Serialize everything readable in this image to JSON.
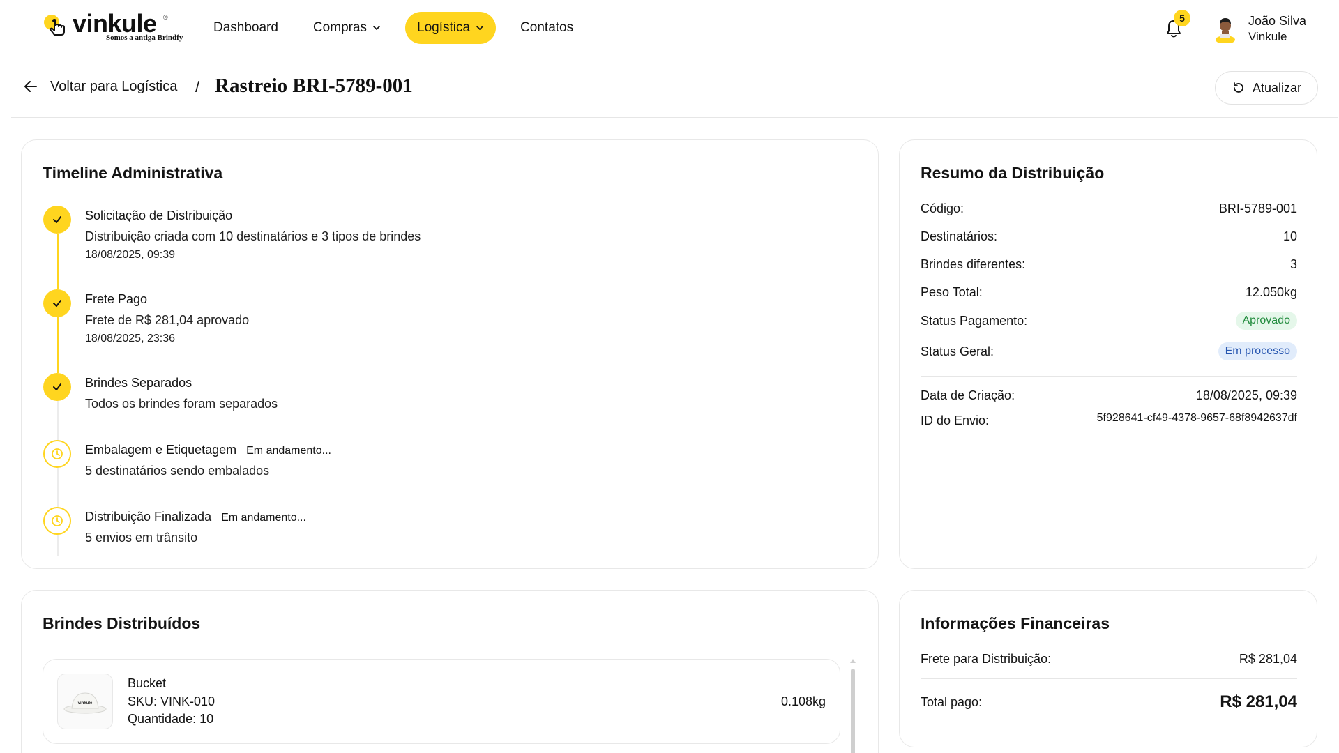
{
  "brand": {
    "name": "vinkule",
    "registered": "®",
    "tagline": "Somos a antiga Brindfy",
    "accent": "#ffd51f"
  },
  "nav": {
    "items": [
      {
        "label": "Dashboard",
        "has_dropdown": false,
        "active": false
      },
      {
        "label": "Compras",
        "has_dropdown": true,
        "active": false
      },
      {
        "label": "Logística",
        "has_dropdown": true,
        "active": true
      },
      {
        "label": "Contatos",
        "has_dropdown": false,
        "active": false
      }
    ]
  },
  "notifications": {
    "count": "5",
    "icon": "bell-icon"
  },
  "user": {
    "name": "João Silva",
    "org": "Vinkule"
  },
  "subheader": {
    "back_label": "Voltar para Logística",
    "separator": "/",
    "title": "Rastreio BRI-5789-001",
    "refresh_label": "Atualizar"
  },
  "timeline": {
    "title": "Timeline Administrativa",
    "steps": [
      {
        "title": "Solicitação de Distribuição",
        "status": "",
        "desc": "Distribuição criada com 10 destinatários e 3 tipos de brindes",
        "date": "18/08/2025, 09:39",
        "done": true
      },
      {
        "title": "Frete Pago",
        "status": "",
        "desc": "Frete de R$ 281,04 aprovado",
        "date": "18/08/2025, 23:36",
        "done": true
      },
      {
        "title": "Brindes Separados",
        "status": "",
        "desc": "Todos os brindes foram separados",
        "date": "",
        "done": true
      },
      {
        "title": "Embalagem e Etiquetagem",
        "status": "Em andamento...",
        "desc": "5 destinatários sendo embalados",
        "date": "",
        "done": false
      },
      {
        "title": "Distribuição Finalizada",
        "status": "Em andamento...",
        "desc": "5 envios em trânsito",
        "date": "",
        "done": false
      }
    ]
  },
  "summary": {
    "title": "Resumo da Distribuição",
    "rows": [
      {
        "label": "Código:",
        "value": "BRI-5789-001"
      },
      {
        "label": "Destinatários:",
        "value": "10"
      },
      {
        "label": "Brindes diferentes:",
        "value": "3"
      },
      {
        "label": "Peso Total:",
        "value": "12.050kg"
      }
    ],
    "payment_status": {
      "label": "Status Pagamento:",
      "value": "Aprovado",
      "color": "#1f8a3b"
    },
    "general_status": {
      "label": "Status Geral:",
      "value": "Em processo",
      "color": "#2756b0"
    },
    "created": {
      "label": "Data de Criação:",
      "value": "18/08/2025, 09:39"
    },
    "shipment_id": {
      "label": "ID do Envio:",
      "value": "5f928641-cf49-4378-9657-68f8942637df"
    }
  },
  "gifts": {
    "title": "Brindes Distribuídos",
    "items": [
      {
        "name": "Bucket",
        "sku": "SKU: VINK-010",
        "quantity": "Quantidade: 10",
        "weight": "0.108kg",
        "thumb_label": "vinkule"
      }
    ]
  },
  "financial": {
    "title": "Informações Financeiras",
    "freight_label": "Frete para Distribuição:",
    "freight_value": "R$ 281,04",
    "total_label": "Total pago:",
    "total_value": "R$ 281,04"
  }
}
